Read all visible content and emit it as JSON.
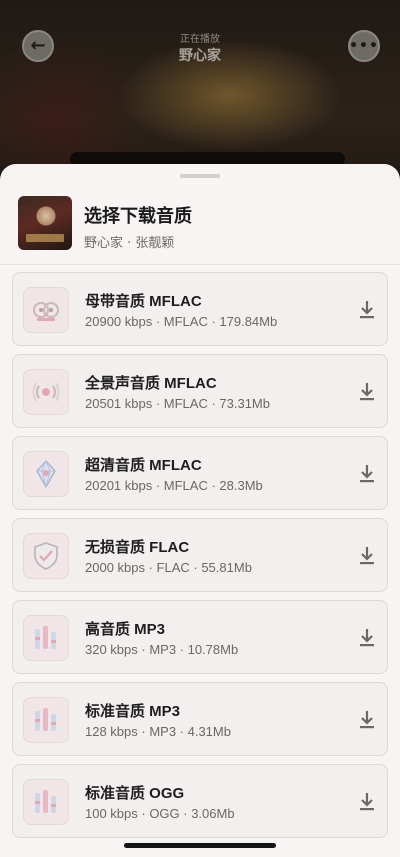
{
  "player": {
    "now_playing_label": "正在播放",
    "song_title": "野心家",
    "back_icon": "←",
    "more_icon": "•••"
  },
  "sheet": {
    "title": "选择下载音质",
    "subtitle": "野心家 · 张靓颖"
  },
  "qualities": [
    {
      "name": "母带音质 MFLAC",
      "meta": "20900 kbps · MFLAC · 179.84Mb",
      "icon": "master-tape-icon"
    },
    {
      "name": "全景声音质 MFLAC",
      "meta": "20501 kbps · MFLAC · 73.31Mb",
      "icon": "surround-sound-icon"
    },
    {
      "name": "超清音质 MFLAC",
      "meta": "20201 kbps · MFLAC · 28.3Mb",
      "icon": "crystal-icon"
    },
    {
      "name": "无损音质 FLAC",
      "meta": "2000 kbps · FLAC · 55.81Mb",
      "icon": "lossless-shield-icon"
    },
    {
      "name": "高音质 MP3",
      "meta": "320 kbps · MP3 · 10.78Mb",
      "icon": "equalizer-icon"
    },
    {
      "name": "标准音质 MP3",
      "meta": "128 kbps · MP3 · 4.31Mb",
      "icon": "equalizer-icon"
    },
    {
      "name": "标准音质 OGG",
      "meta": "100 kbps · OGG · 3.06Mb",
      "icon": "equalizer-icon"
    }
  ],
  "colors": {
    "sheet_bg": "#f8f4f4",
    "item_bg": "#f4efef",
    "icon_tint": "#e9b9c3"
  }
}
